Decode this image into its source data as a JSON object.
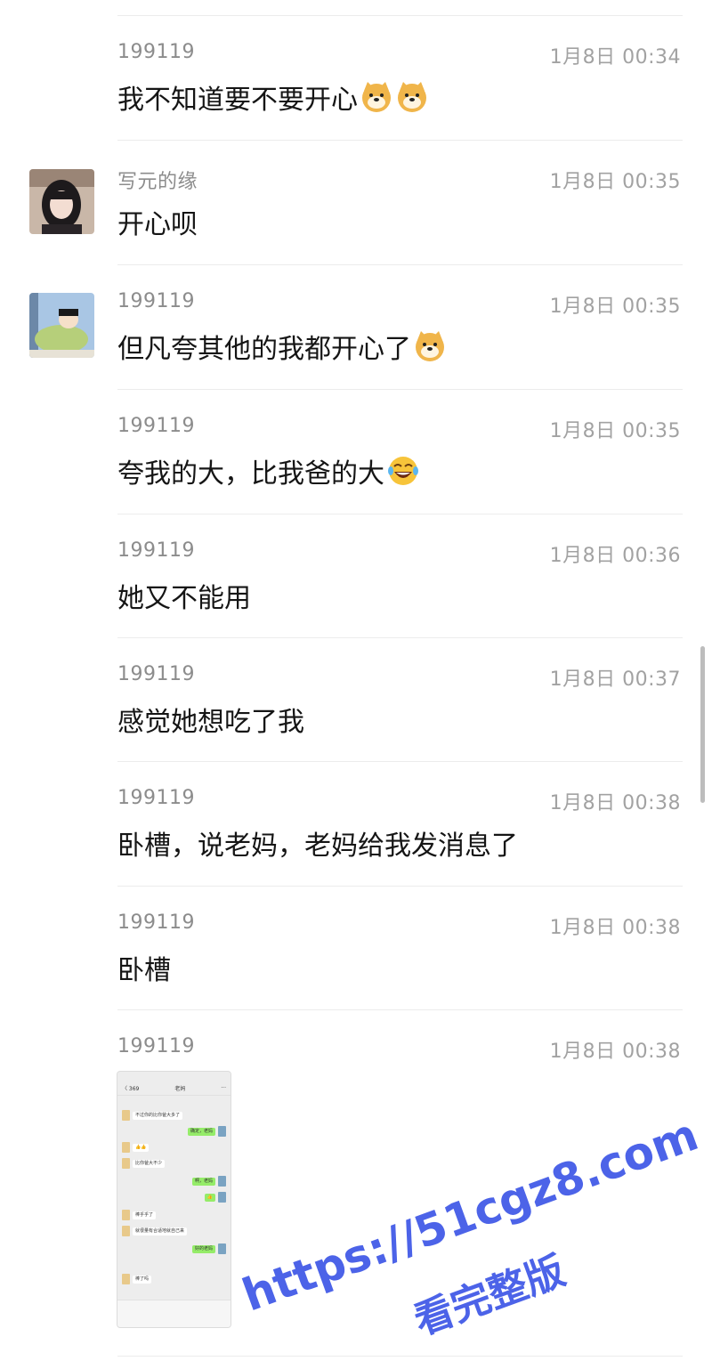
{
  "messages": [
    {
      "sender": "199119",
      "time": "1月8日 00:34",
      "text": "我不知道要不要开心",
      "emoji": [
        "doge-emoji",
        "doge-emoji"
      ]
    },
    {
      "sender": "写元的缘",
      "time": "1月8日 00:35",
      "text": "开心呗",
      "emoji": []
    },
    {
      "sender": "199119",
      "time": "1月8日 00:35",
      "text": "但凡夸其他的我都开心了",
      "emoji": [
        "doge-emoji"
      ]
    },
    {
      "sender": "199119",
      "time": "1月8日 00:35",
      "text": "夸我的大，比我爸的大",
      "emoji": [
        "laugh-cry-emoji"
      ]
    },
    {
      "sender": "199119",
      "time": "1月8日 00:36",
      "text": "她又不能用",
      "emoji": []
    },
    {
      "sender": "199119",
      "time": "1月8日 00:37",
      "text": "感觉她想吃了我",
      "emoji": []
    },
    {
      "sender": "199119",
      "time": "1月8日 00:38",
      "text": "卧槽，说老妈，老妈给我发消息了",
      "emoji": []
    },
    {
      "sender": "199119",
      "time": "1月8日 00:38",
      "text": "卧槽",
      "emoji": []
    },
    {
      "sender": "199119",
      "time": "1月8日 00:38",
      "text": "",
      "emoji": []
    }
  ],
  "screenshot": {
    "back_label": "〈 369",
    "title": "老妈",
    "more": "···",
    "lines": [
      {
        "side": "l",
        "text": "不过你的比你爸大多了"
      },
      {
        "side": "r",
        "text": "确定，老妈"
      },
      {
        "side": "l",
        "text": "👍👍"
      },
      {
        "side": "l",
        "text": "比你爸大不少"
      },
      {
        "side": "r",
        "text": "啊，老妈"
      },
      {
        "side": "r",
        "text": "👍"
      },
      {
        "side": "l",
        "text": "棒乎乎了"
      },
      {
        "side": "l",
        "text": "就很量有合适地就自己来"
      },
      {
        "side": "r",
        "text": "好的老妈"
      },
      {
        "side": "l",
        "text": "棒了吗"
      }
    ]
  },
  "watermark": {
    "url": "https://51cgz8.com",
    "note": "看完整版"
  },
  "colors": {
    "sender": "#8c8c8c",
    "time": "#a2a2a2",
    "divider": "#ececec",
    "watermark": "#4c63e8"
  }
}
